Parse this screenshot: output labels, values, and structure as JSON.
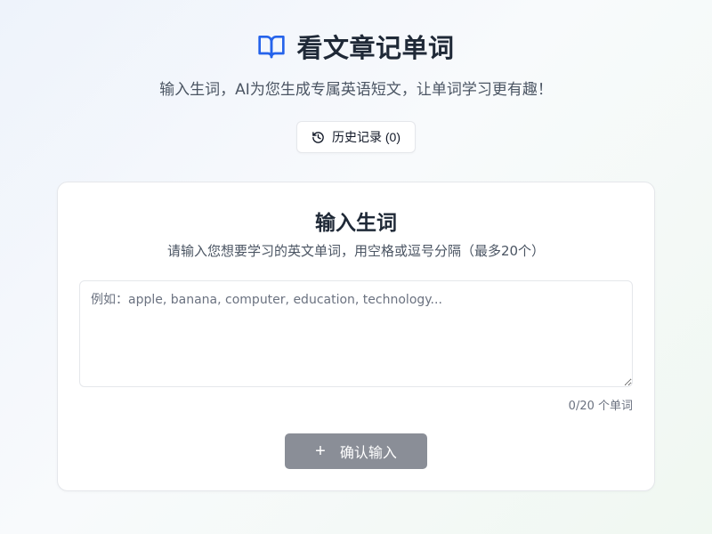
{
  "header": {
    "title": "看文章记单词",
    "subtitle": "输入生词，AI为您生成专属英语短文，让单词学习更有趣！",
    "icon": "book-open-icon",
    "icon_color": "#2563eb"
  },
  "history_button": {
    "label": "历史记录 (0)",
    "icon": "history-icon"
  },
  "input_card": {
    "title": "输入生词",
    "description": "请输入您想要学习的英文单词，用空格或逗号分隔（最多20个）",
    "textarea": {
      "value": "",
      "placeholder": "例如：apple, banana, computer, education, technology..."
    },
    "word_count": "0/20 个单词",
    "confirm_button": {
      "icon": "+",
      "label": "确认输入",
      "color": "#8a8e97"
    }
  }
}
